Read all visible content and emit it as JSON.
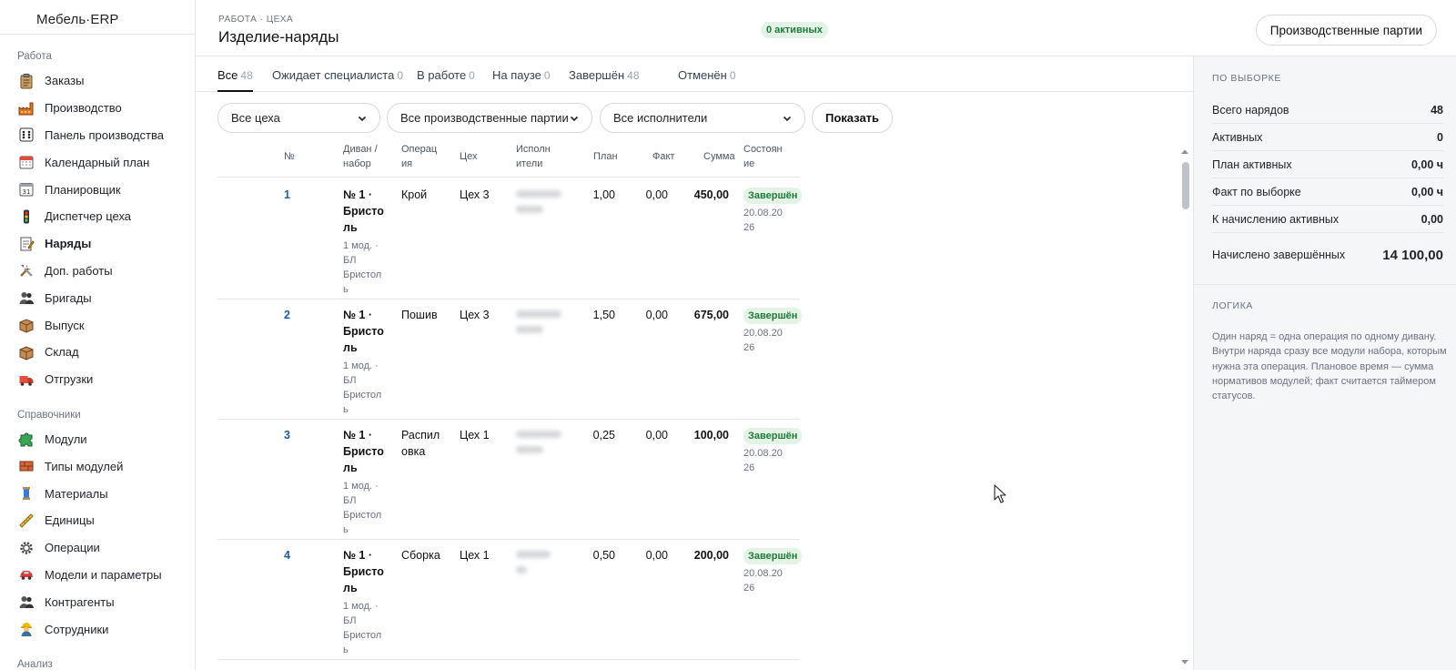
{
  "app": {
    "brand": "Мебель·ERP"
  },
  "sidebar": {
    "sections": [
      {
        "title": "Работа",
        "items": [
          {
            "label": "Заказы",
            "icon": "clipboard-icon",
            "active": false
          },
          {
            "label": "Производство",
            "icon": "factory-icon",
            "active": false
          },
          {
            "label": "Панель производства",
            "icon": "dice-grid-icon",
            "active": false
          },
          {
            "label": "Календарный план",
            "icon": "calendar-icon",
            "active": false
          },
          {
            "label": "Планировщик",
            "icon": "calendar-31-icon",
            "active": false
          },
          {
            "label": "Диспетчер цеха",
            "icon": "traffic-light-icon",
            "active": false
          },
          {
            "label": "Наряды",
            "icon": "memo-icon",
            "active": true
          },
          {
            "label": "Доп. работы",
            "icon": "tools-icon",
            "active": false
          },
          {
            "label": "Бригады",
            "icon": "people-icon",
            "active": false
          },
          {
            "label": "Выпуск",
            "icon": "box-icon",
            "active": false
          },
          {
            "label": "Склад",
            "icon": "box-icon",
            "active": false
          },
          {
            "label": "Отгрузки",
            "icon": "truck-icon",
            "active": false
          }
        ]
      },
      {
        "title": "Справочники",
        "items": [
          {
            "label": "Модули",
            "icon": "puzzle-icon",
            "active": false
          },
          {
            "label": "Типы модулей",
            "icon": "bricks-icon",
            "active": false
          },
          {
            "label": "Материалы",
            "icon": "thread-icon",
            "active": false
          },
          {
            "label": "Единицы",
            "icon": "ruler-icon",
            "active": false
          },
          {
            "label": "Операции",
            "icon": "gear-icon",
            "active": false
          },
          {
            "label": "Модели и параметры",
            "icon": "car-icon",
            "active": false
          },
          {
            "label": "Контрагенты",
            "icon": "people-icon",
            "active": false
          },
          {
            "label": "Сотрудники",
            "icon": "worker-icon",
            "active": false
          }
        ]
      },
      {
        "title": "Анализ",
        "items": []
      }
    ]
  },
  "header": {
    "breadcrumb": "РАБОТА · ЦЕХА",
    "title": "Изделие-наряды",
    "active_badge": "0 активных",
    "batches_button": "Производственные партии"
  },
  "tabs": [
    {
      "label": "Все",
      "count": "48",
      "active": true
    },
    {
      "label": "Ожидает специалиста",
      "count": "0",
      "active": false
    },
    {
      "label": "В работе",
      "count": "0",
      "active": false
    },
    {
      "label": "На паузе",
      "count": "0",
      "active": false
    },
    {
      "label": "Завершён",
      "count": "48",
      "active": false
    },
    {
      "label": "Отменён",
      "count": "0",
      "active": false
    }
  ],
  "filters": {
    "shop": "Все цеха",
    "batch": "Все производственные партии",
    "executor": "Все исполнители",
    "show_button": "Показать"
  },
  "table": {
    "columns": [
      "№",
      "Диван / набор",
      "Операц ия",
      "Цех",
      "Исполн ители",
      "План",
      "Факт",
      "Сумма",
      "Состоян ие"
    ],
    "rows": [
      {
        "num": "1",
        "sofa": "№ 1 · Бристо ль",
        "sofa_sub": "1 мод. · БЛ Бристол ь",
        "operation": "Крой",
        "shop": "Цех 3",
        "plan": "1,00",
        "fact": "0,00",
        "sum": "450,00",
        "status": "Завершён",
        "date": "20.08.20 26"
      },
      {
        "num": "2",
        "sofa": "№ 1 · Бристо ль",
        "sofa_sub": "1 мод. · БЛ Бристол ь",
        "operation": "Пошив",
        "shop": "Цех 3",
        "plan": "1,50",
        "fact": "0,00",
        "sum": "675,00",
        "status": "Завершён",
        "date": "20.08.20 26"
      },
      {
        "num": "3",
        "sofa": "№ 1 · Бристо ль",
        "sofa_sub": "1 мод. · БЛ Бристол ь",
        "operation": "Распил овка",
        "shop": "Цех 1",
        "plan": "0,25",
        "fact": "0,00",
        "sum": "100,00",
        "status": "Завершён",
        "date": "20.08.20 26"
      },
      {
        "num": "4",
        "sofa": "№ 1 · Бристо ль",
        "sofa_sub": "1 мод. · БЛ Бристол ь",
        "operation": "Сборка",
        "shop": "Цех 1",
        "plan": "0,50",
        "fact": "0,00",
        "sum": "200,00",
        "status": "Завершён",
        "date": "20.08.20 26"
      }
    ]
  },
  "summary": {
    "heading": "ПО ВЫБОРКЕ",
    "rows": [
      {
        "label": "Всего нарядов",
        "value": "48"
      },
      {
        "label": "Активных",
        "value": "0"
      },
      {
        "label": "План активных",
        "value": "0,00 ч"
      },
      {
        "label": "Факт по выборке",
        "value": "0,00 ч"
      },
      {
        "label": "К начислению активных",
        "value": "0,00"
      }
    ],
    "total_label": "Начислено завершённых",
    "total_value": "14 100,00"
  },
  "logic": {
    "heading": "ЛОГИКА",
    "text": "Один наряд = одна операция по одному дивану. Внутри наряда сразу все модули набора, которым нужна эта операция. Плановое время — сумма нормативов модулей; факт считается таймером статусов."
  },
  "colors": {
    "accent_link": "#1f5fa8",
    "status_done_bg": "#e3f4e6",
    "status_done_fg": "#1f7a3a",
    "panel_bg": "#f5f6f7"
  }
}
